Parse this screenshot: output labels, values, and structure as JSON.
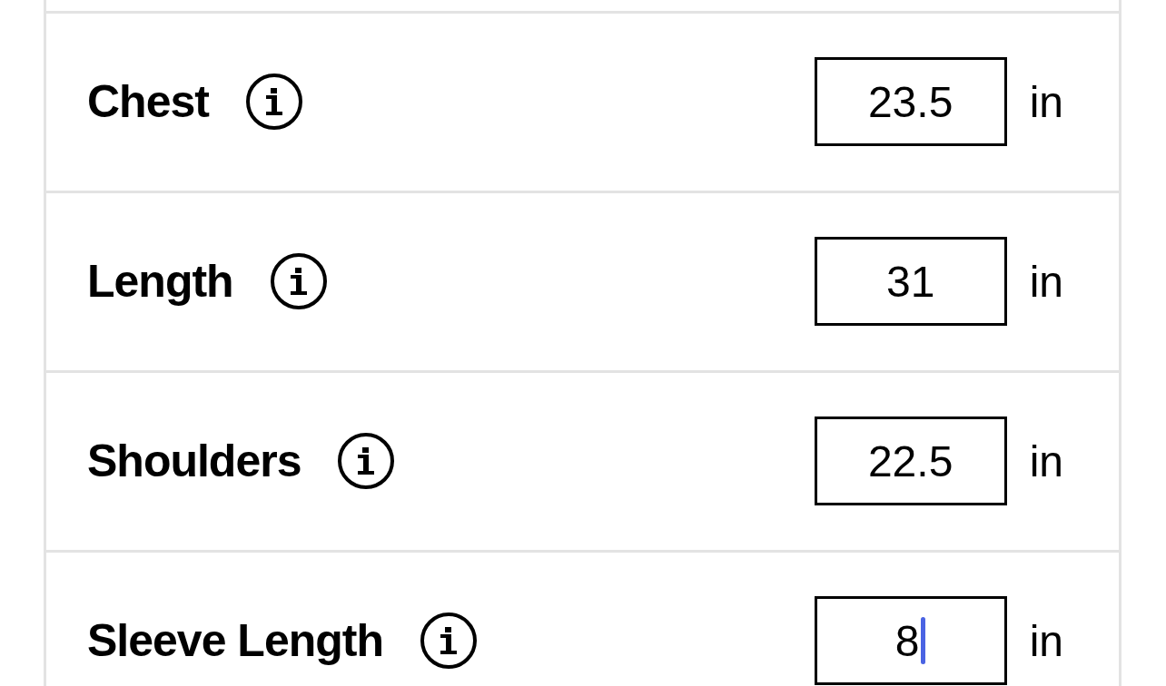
{
  "measurements": [
    {
      "label": "Chest",
      "value": "23.5",
      "unit": "in",
      "focused": false
    },
    {
      "label": "Length",
      "value": "31",
      "unit": "in",
      "focused": false
    },
    {
      "label": "Shoulders",
      "value": "22.5",
      "unit": "in",
      "focused": false
    },
    {
      "label": "Sleeve Length",
      "value": "8",
      "unit": "in",
      "focused": true
    }
  ]
}
